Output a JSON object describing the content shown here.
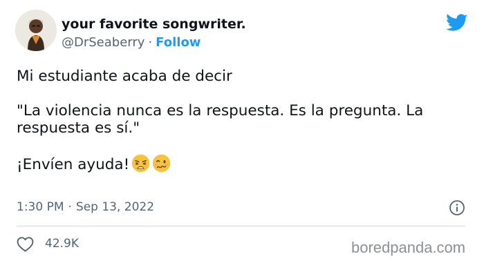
{
  "author": {
    "display_name": "your favorite songwriter.",
    "handle": "@DrSeaberry",
    "separator": "·",
    "follow_label": "Follow"
  },
  "tweet": {
    "line1": "Mi estudiante acaba de decir",
    "line2": "\"La violencia nunca es la respuesta. Es la pregunta. La respuesta es sí.\"",
    "line3": "¡Envíen ayuda!",
    "emojis": [
      "weary-face-emoji",
      "woozy-face-emoji"
    ]
  },
  "meta": {
    "time": "1:30 PM",
    "separator": "·",
    "date": "Sep 13, 2022"
  },
  "engagement": {
    "likes": "42.9K"
  },
  "watermark": "boredpanda.com",
  "colors": {
    "twitter_blue": "#1d9bf0",
    "secondary_text": "#536471",
    "primary_text": "#0f1419",
    "divider": "#cfd9de",
    "emoji_yellow": "#f7c33e"
  },
  "icons": [
    "twitter-bird-icon",
    "info-icon",
    "heart-icon"
  ]
}
